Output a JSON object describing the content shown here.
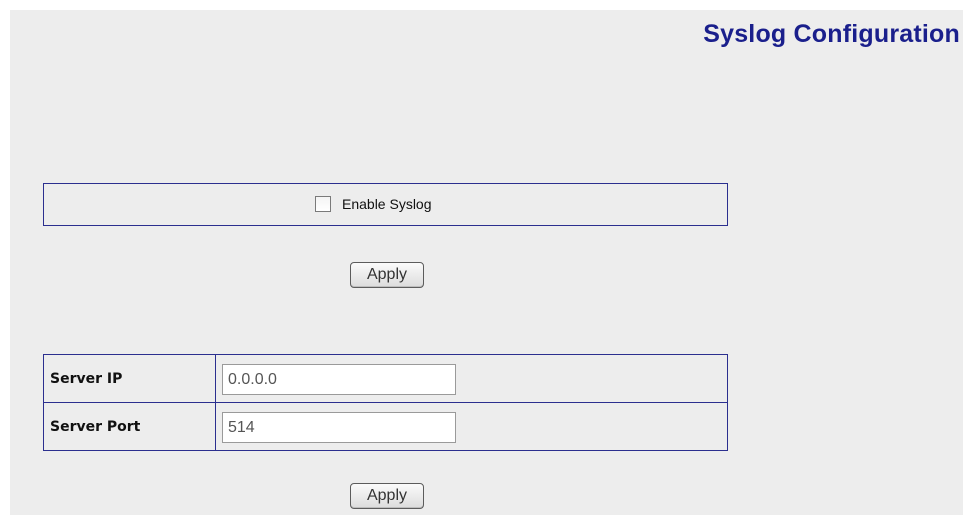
{
  "page": {
    "title": "Syslog Configuration"
  },
  "enable_section": {
    "checkbox_label": "Enable Syslog",
    "checked": false,
    "apply_label": "Apply"
  },
  "server_section": {
    "rows": [
      {
        "label": "Server IP",
        "value": "0.0.0.0"
      },
      {
        "label": "Server Port",
        "value": "514"
      }
    ],
    "apply_label": "Apply"
  },
  "colors": {
    "title": "#1a1f8c",
    "border": "#2b2f8f",
    "panel_background": "#ededed"
  }
}
